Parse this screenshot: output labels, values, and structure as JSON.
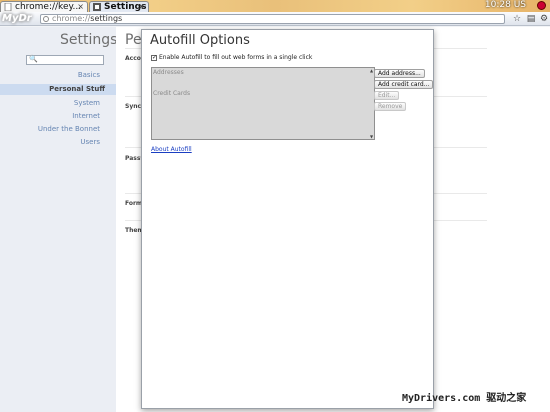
{
  "tabs": [
    {
      "label": "chrome://key..."
    },
    {
      "label": "Settings"
    }
  ],
  "system": {
    "clock": "10:28 US"
  },
  "toolbar": {
    "logo": "MyDr",
    "url_scheme": "chrome://",
    "url_path": "settings"
  },
  "sidebar": {
    "title": "Settings",
    "items": [
      {
        "label": "Basics"
      },
      {
        "label": "Personal Stuff"
      },
      {
        "label": "System"
      },
      {
        "label": "Internet"
      },
      {
        "label": "Under the Bonnet"
      },
      {
        "label": "Users"
      }
    ]
  },
  "content": {
    "title": "Pe",
    "sections": [
      {
        "label": "Acco"
      },
      {
        "label": "Sync"
      },
      {
        "label": "Passw"
      },
      {
        "label": "Form"
      },
      {
        "label": "Them"
      }
    ]
  },
  "dialog": {
    "title": "Autofill Options",
    "checkbox_label": "Enable Autofill to fill out web forms in a single click",
    "checkbox_checked": true,
    "list_items": [
      "Addresses",
      "Credit Cards"
    ],
    "buttons": [
      {
        "label": "Add address...",
        "enabled": true
      },
      {
        "label": "Add credit card...",
        "enabled": true
      },
      {
        "label": "Edit...",
        "enabled": false
      },
      {
        "label": "Remove",
        "enabled": false
      }
    ],
    "link": "About Autofill"
  },
  "watermark": "MyDrivers.com 驱动之家"
}
